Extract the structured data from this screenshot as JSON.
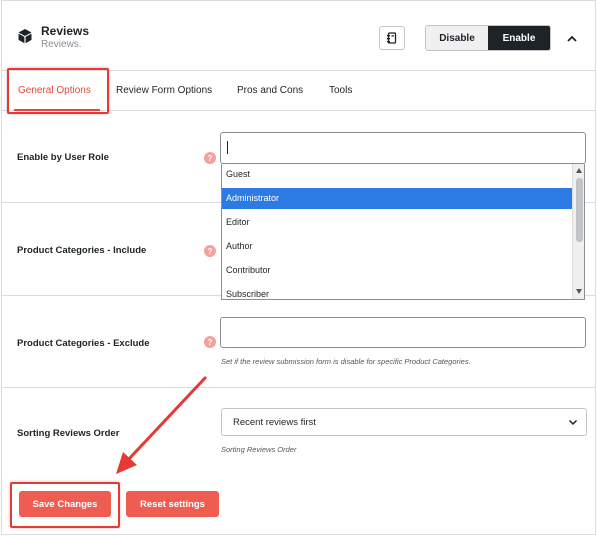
{
  "header": {
    "title": "Reviews",
    "subtitle": "Reviews.",
    "disable_label": "Disable",
    "enable_label": "Enable"
  },
  "tabs": [
    {
      "label": "General Options",
      "active": true
    },
    {
      "label": "Review Form Options",
      "active": false
    },
    {
      "label": "Pros and Cons",
      "active": false
    },
    {
      "label": "Tools",
      "active": false
    }
  ],
  "fields": {
    "user_role": {
      "label": "Enable by User Role",
      "value": "",
      "options": [
        "Guest",
        "Administrator",
        "Editor",
        "Author",
        "Contributor",
        "Subscriber"
      ],
      "highlighted": "Administrator"
    },
    "cat_include": {
      "label": "Product Categories - Include"
    },
    "cat_exclude": {
      "label": "Product Categories - Exclude",
      "description": "Set if the review submission form is disable for specific Product Categories."
    },
    "sorting": {
      "label": "Sorting Reviews Order",
      "value": "Recent reviews first",
      "description": "Sorting Reviews Order"
    }
  },
  "help_glyph": "?",
  "actions": {
    "save_label": "Save Changes",
    "reset_label": "Reset settings"
  },
  "colors": {
    "accent": "#e2493c",
    "button": "#ef5d52",
    "selected_option": "#2c7be5",
    "annotation": "#e53935"
  },
  "icons": {
    "module": "cube-icon",
    "docs": "document-icon",
    "collapse": "chevron-up-icon",
    "select": "chevron-down-icon"
  }
}
